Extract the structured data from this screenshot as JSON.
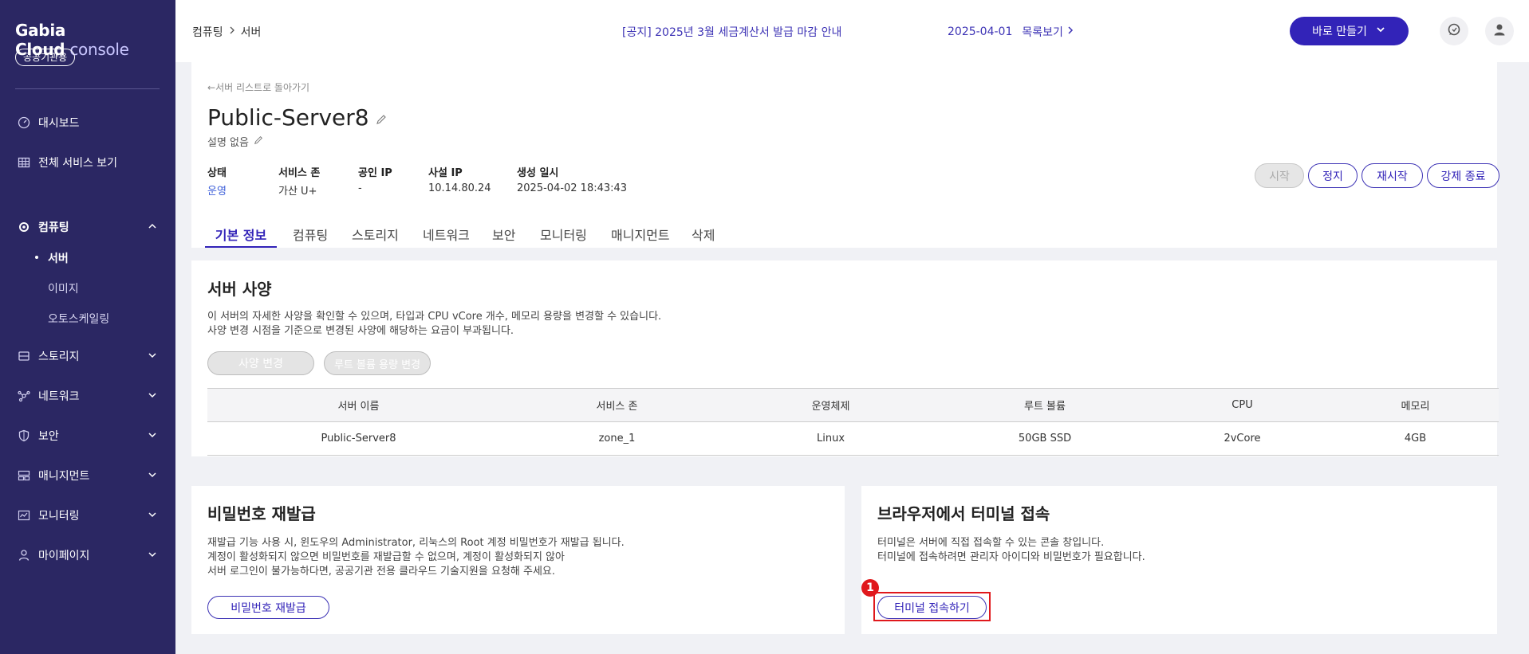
{
  "sidebar": {
    "brand": "Gabia Cloud",
    "brand_suffix": "console",
    "badge": "공공기관용",
    "items": [
      {
        "label": "대시보드"
      },
      {
        "label": "전체 서비스 보기"
      },
      {
        "label": "컴퓨팅"
      },
      {
        "label": "스토리지"
      },
      {
        "label": "네트워크"
      },
      {
        "label": "보안"
      },
      {
        "label": "매니지먼트"
      },
      {
        "label": "모니터링"
      },
      {
        "label": "마이페이지"
      }
    ],
    "sub_items": [
      {
        "label": "서버"
      },
      {
        "label": "이미지"
      },
      {
        "label": "오토스케일링"
      }
    ]
  },
  "topbar": {
    "breadcrumb": [
      "컴퓨팅",
      "서버"
    ],
    "notice": "[공지] 2025년 3월 세금계산서 발급 마감 안내",
    "notice_date": "2025-04-01",
    "notice_list": "목록보기",
    "create_button": "바로 만들기"
  },
  "server": {
    "back_link": "서버 리스트로 돌아가기",
    "name": "Public-Server8",
    "description": "설명 없음",
    "info": [
      {
        "label": "상태",
        "value": "운영"
      },
      {
        "label": "서비스 존",
        "value": "가산 U+"
      },
      {
        "label": "공인 IP",
        "value": "-"
      },
      {
        "label": "사설 IP",
        "value": "10.14.80.24"
      },
      {
        "label": "생성 일시",
        "value": "2025-04-02 18:43:43"
      }
    ],
    "actions": {
      "start": "시작",
      "stop": "정지",
      "restart": "재시작",
      "force_stop": "강제 종료"
    },
    "tabs": [
      "기본 정보",
      "컴퓨팅",
      "스토리지",
      "네트워크",
      "보안",
      "모니터링",
      "매니지먼트",
      "삭제"
    ]
  },
  "spec": {
    "title": "서버 사양",
    "text_line1": "이 서버의 자세한 사양을 확인할 수 있으며, 타입과 CPU vCore 개수, 메모리 용량을 변경할 수 있습니다.",
    "text_line2": "사양 변경 시점을 기준으로 변경된 사양에 해당하는 요금이 부과됩니다.",
    "change_spec_button": "사양 변경",
    "change_root_button": "루트 볼륨 용량 변경",
    "table": {
      "headers": [
        "서버 이름",
        "서비스 존",
        "운영체제",
        "루트 볼륨",
        "CPU",
        "메모리"
      ],
      "row": [
        "Public-Server8",
        "zone_1",
        "Linux",
        "50GB SSD",
        "2vCore",
        "4GB"
      ]
    }
  },
  "password": {
    "title": "비밀번호 재발급",
    "line1": "재발급 기능 사용 시, 윈도우의 Administrator, 리눅스의 Root 계정 비밀번호가 재발급 됩니다.",
    "line2": "계정이 활성화되지 않으면 비밀번호를 재발급할 수 없으며, 계정이 활성화되지 않아",
    "line3": "서버 로그인이 불가능하다면, 공공기관 전용 클라우드 기술지원을 요청해 주세요.",
    "button": "비밀번호 재발급"
  },
  "terminal": {
    "title": "브라우저에서 터미널 접속",
    "line1": "터미널은 서버에 직접 접속할 수 있는 콘솔 창입니다.",
    "line2": "터미널에 접속하려면 관리자 아이디와 비밀번호가 필요합니다.",
    "button": "터미널 접속하기",
    "step": "1"
  },
  "colors": {
    "sidebar_bg": "#2b2763",
    "accent": "#3223b8",
    "highlight": "#e0181c"
  }
}
